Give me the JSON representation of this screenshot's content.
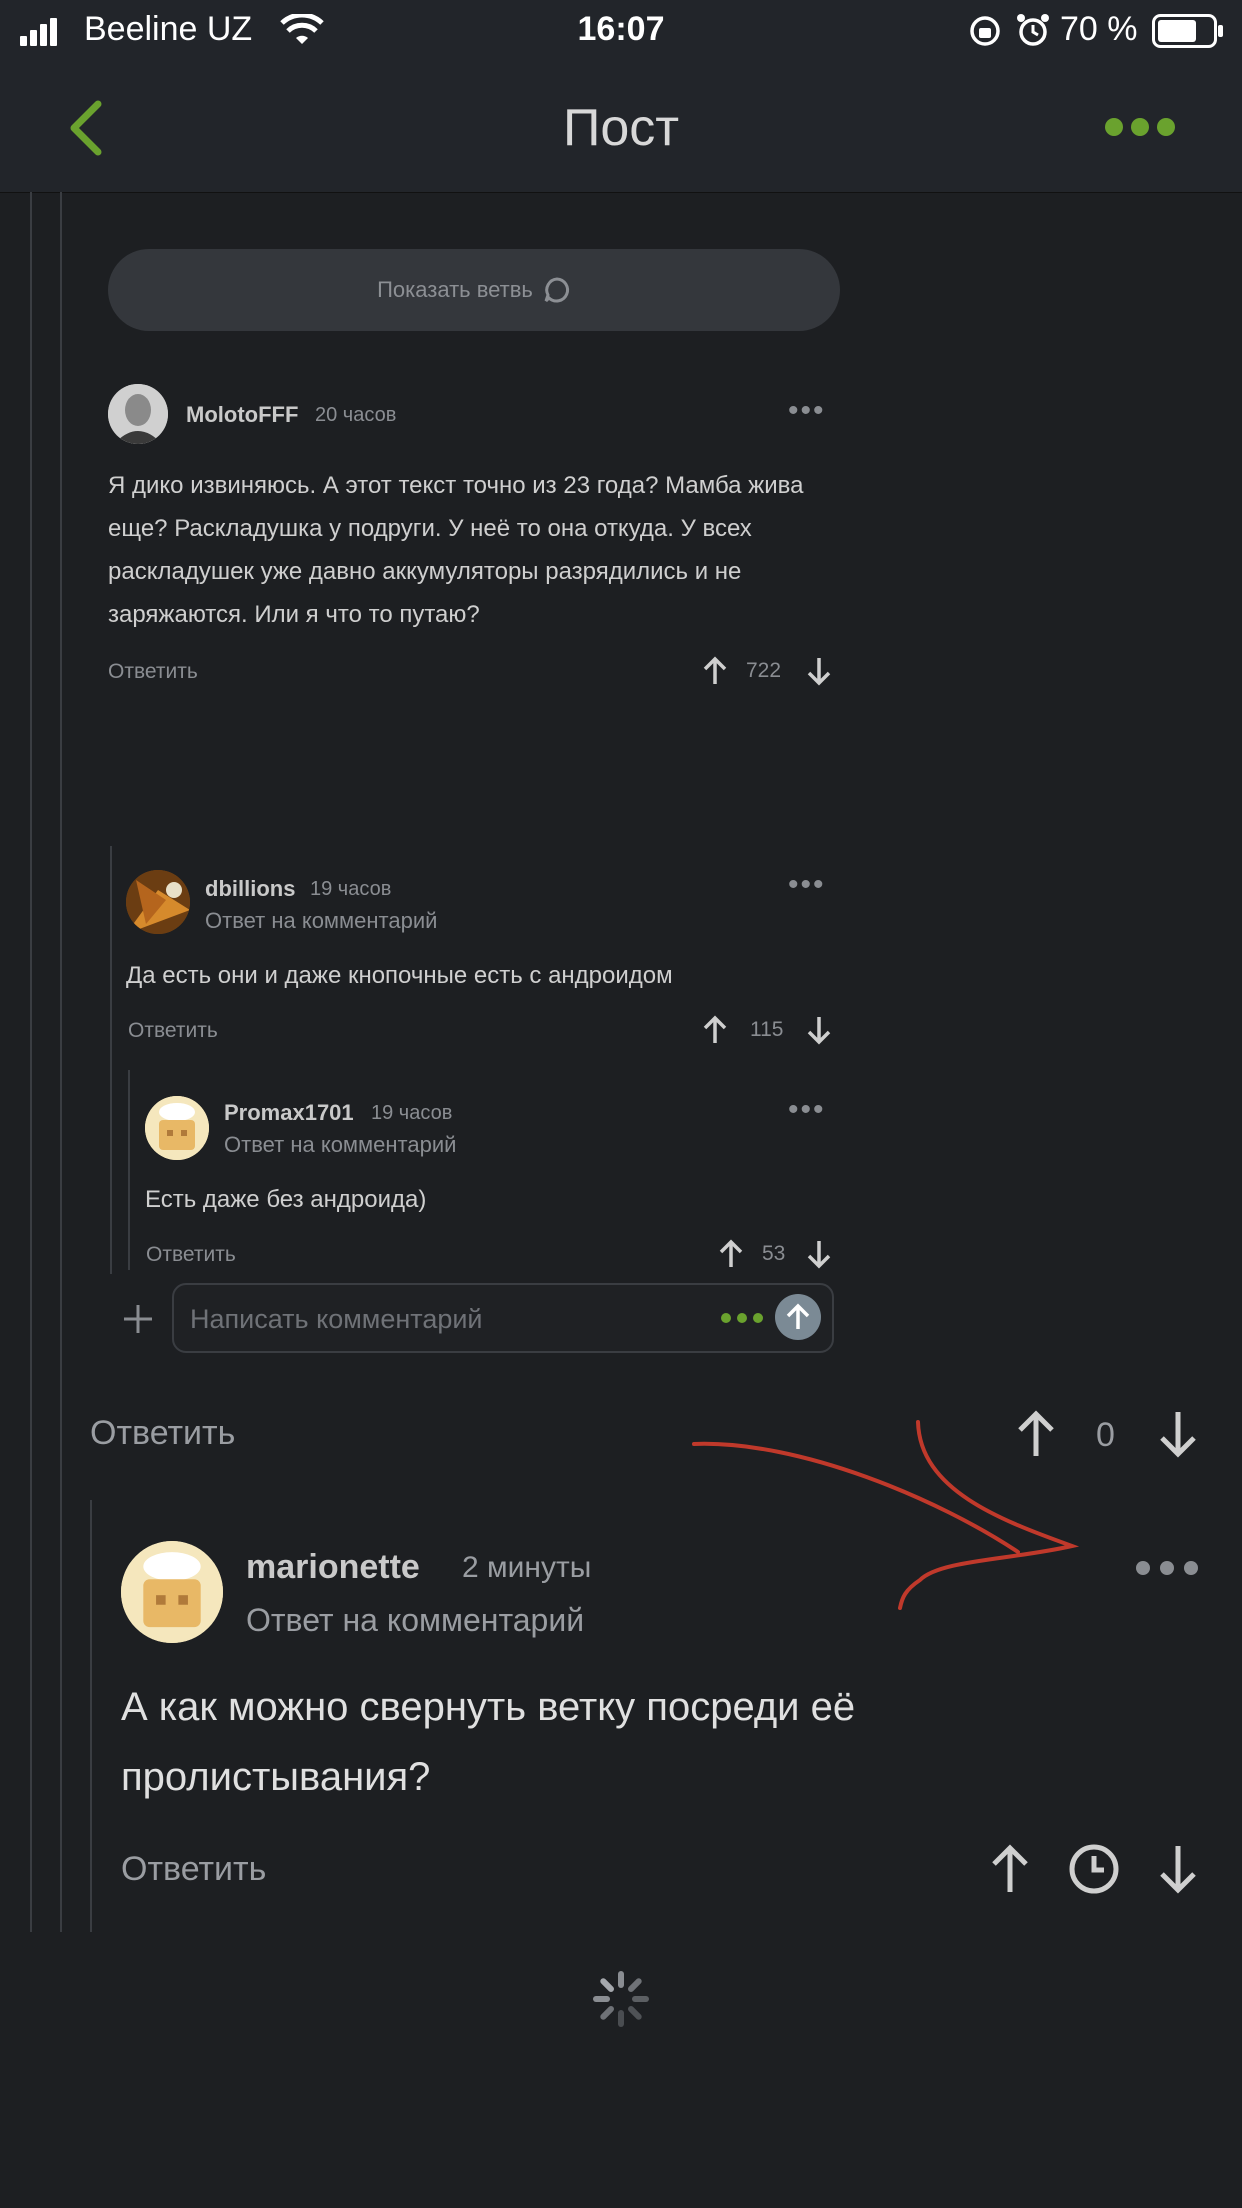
{
  "status": {
    "carrier": "Beeline UZ",
    "time": "16:07",
    "battery": "70 %"
  },
  "nav": {
    "back_icon": "chevron-left-icon",
    "title": "Пост",
    "menu_icon": "more-dots-icon",
    "accent": "#6aa22e"
  },
  "thread": {
    "show_branch_label": "Показать ветвь",
    "input_placeholder": "Написать комментарий",
    "outer_reply_label": "Ответить",
    "outer_vote": "0",
    "comments": [
      {
        "user": "MolotoFFF",
        "time": "20 часов",
        "text": "Я дико извиняюсь. А этот текст точно из 23 года? Мамба жива еще? Раскладушка у подруги. У неё то она откуда. У всех раскладушек уже давно аккумуляторы разрядились и не заряжаются. Или я что то путаю?",
        "reply": "Ответить",
        "votes": "722"
      },
      {
        "user": "dbillions",
        "time": "19 часов",
        "subtitle": "Ответ на комментарий",
        "text": "Да есть они и даже кнопочные есть с андроидом",
        "reply": "Ответить",
        "votes": "115"
      },
      {
        "user": "Promax1701",
        "time": "19 часов",
        "subtitle": "Ответ на комментарий",
        "text": "Есть даже без андроида)",
        "reply": "Ответить",
        "votes": "53"
      }
    ]
  },
  "main_comment": {
    "user": "marionette",
    "time": "2 минуты",
    "subtitle": "Ответ на комментарий",
    "text_line1": "А как можно свернуть ветку посреди её",
    "text_line2": "пролистывания?",
    "reply": "Ответить"
  }
}
